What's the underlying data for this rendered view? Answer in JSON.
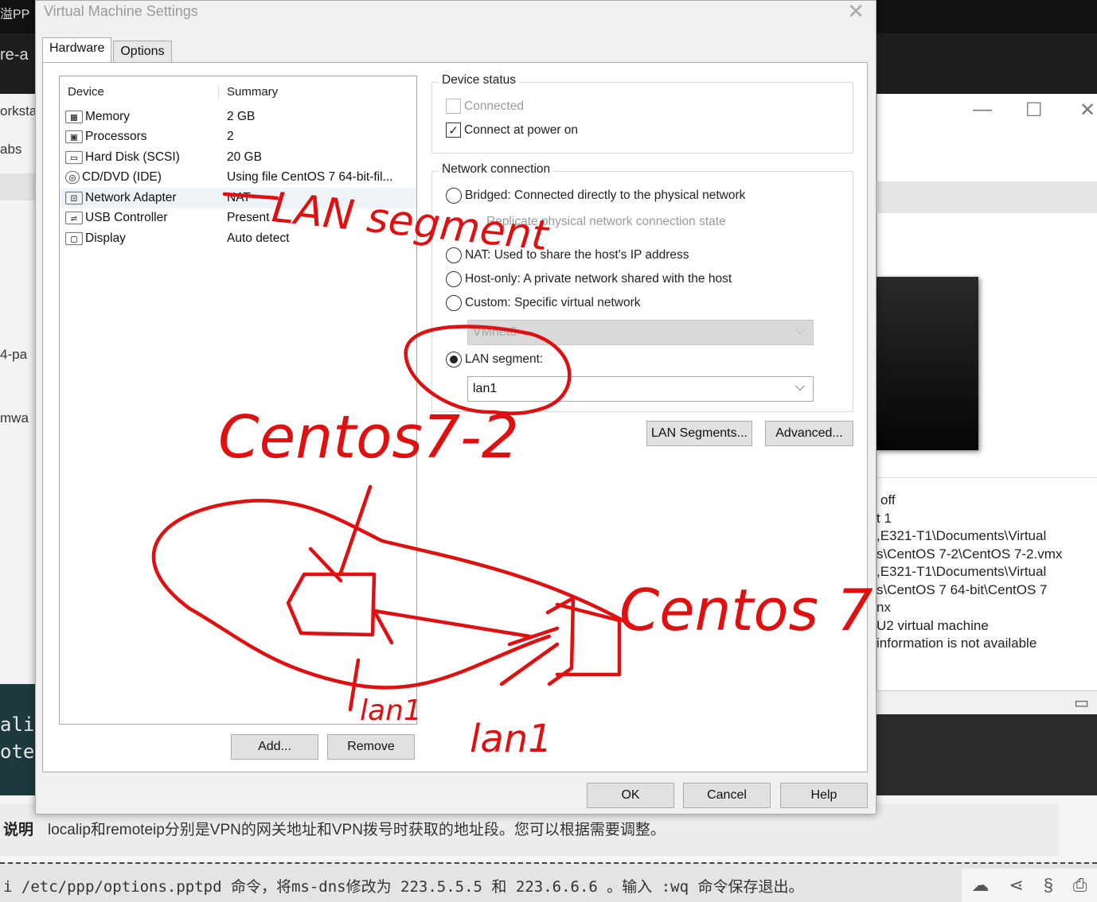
{
  "background": {
    "top_left_fragment": "溢PP",
    "left_fragments": [
      "re-a",
      "orksta",
      "abs",
      "4-pa",
      "mwa"
    ],
    "left_terminal_lines": [
      "ali",
      "ote"
    ],
    "right_details": [
      "off",
      "t 1",
      ",E321-T1\\Documents\\Virtual",
      "s\\CentOS 7-2\\CentOS 7-2.vmx",
      ",E321-T1\\Documents\\Virtual",
      "s\\CentOS 7 64-bit\\CentOS 7",
      "nx",
      "U2 virtual machine",
      " information is not available"
    ],
    "note_label": "说明",
    "note_text": "localip和remoteip分别是VPN的网关地址和VPN拨号时获取的地址段。您可以根据需要调整。",
    "command_text": "i /etc/ppp/options.pptpd 命令，将ms-dns修改为 223.5.5.5 和 223.6.6.6 。输入 :wq 命令保存退出。"
  },
  "dialog": {
    "title": "Virtual Machine Settings",
    "tabs": [
      "Hardware",
      "Options"
    ],
    "device_list": {
      "headers": {
        "device": "Device",
        "summary": "Summary"
      },
      "rows": [
        {
          "icon": "memory-icon",
          "device": "Memory",
          "summary": "2 GB"
        },
        {
          "icon": "processor-icon",
          "device": "Processors",
          "summary": "2"
        },
        {
          "icon": "hard-disk-icon",
          "device": "Hard Disk (SCSI)",
          "summary": "20 GB"
        },
        {
          "icon": "cd-dvd-icon",
          "device": "CD/DVD (IDE)",
          "summary": "Using file CentOS 7 64-bit-fil..."
        },
        {
          "icon": "network-adapter-icon",
          "device": "Network Adapter",
          "summary": "NAT"
        },
        {
          "icon": "usb-icon",
          "device": "USB Controller",
          "summary": "Present"
        },
        {
          "icon": "display-icon",
          "device": "Display",
          "summary": "Auto detect"
        }
      ]
    },
    "add_button": "Add...",
    "remove_button": "Remove",
    "device_status": {
      "label": "Device status",
      "connected": "Connected",
      "connect_at_power_on": "Connect at power on"
    },
    "network_connection": {
      "label": "Network connection",
      "bridged": "Bridged: Connected directly to the physical network",
      "replicate": "Replicate physical network connection state",
      "nat": "NAT: Used to share the host's IP address",
      "host_only": "Host-only: A private network shared with the host",
      "custom": "Custom: Specific virtual network",
      "custom_value": "VMnet0",
      "lan_segment": "LAN segment:",
      "lan_value": "lan1",
      "selected": "lan_segment"
    },
    "lan_segments_button": "LAN Segments...",
    "advanced_button": "Advanced...",
    "ok_button": "OK",
    "cancel_button": "Cancel",
    "help_button": "Help"
  },
  "annotations": {
    "label_lan_segment": "LAN segment",
    "label_vm_a": "Centos7-2",
    "label_vm_b": "Centos 7",
    "label_link_a": "lan1",
    "label_link_b": "lan1",
    "ink_color": "#e01010"
  }
}
